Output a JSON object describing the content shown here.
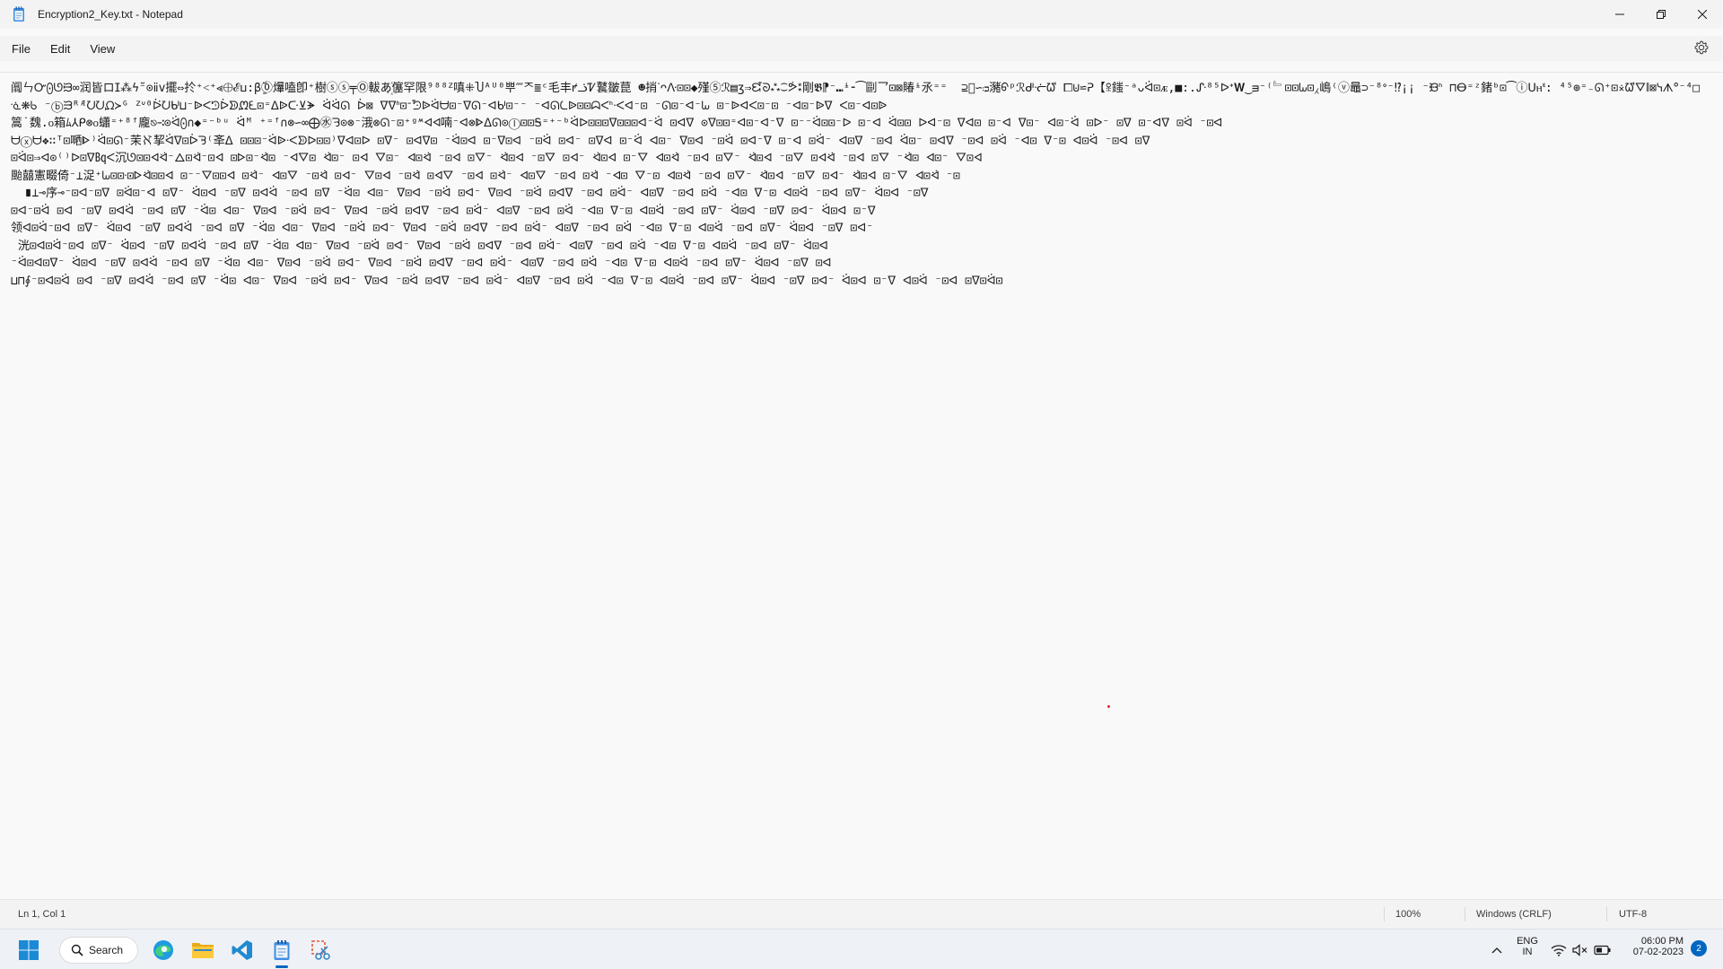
{
  "window": {
    "title": "Encryption2_Key.txt - Notepad"
  },
  "menu": {
    "items": [
      "File",
      "Edit",
      "View"
    ]
  },
  "editor": {
    "content": "阘ㄣᏅ⨀ᘎᙣ∞润皆ロⵊ⁂ϟ̃⁻⊙ⅱ‍v擺⇔扵⁺˂⁺⪡⨁ℰⳙ꞉β̱̆⓪爗嗑卽⁺樹ⓢⓢ╤Ⓞ軷あ꙰僿罕限⁹⁸⁸ᙆ嗔⁜Ⴎᴬᵁ⁰뿌⁗ᄌ≣ᶜ毛丰ꝵᓘᏤ鼚皺菎 ☻捎ᐝᴖᐽ⊡⊡◆殣⑤ℛ▤ʒ⇒ᘿᘐ⁂⁐ᕘ⁑剛𝕭⁋⁻⑉ᶤ⁃⁀剾乛⊡⊠賰ᶤ氶⁼⁼  ⊇᷁∽ᴞ瀦ᠪᵖℛᒇᓠᘺ ⧠⊍⋍ᕈ【ꕉ⁠䥀⁻ᵃᴗᐛ⊡ᴁ,■:.ᔚ⁸⁵ᐅᐩ𝐖‿ᴟ⁻⁽﹄⊡⊡ᘈ⊡⁁嶋⁽ⓥ鼂⊃⁻⁸ᐤ⁻⁉¡¡ ⁻ᙟᑋ ⊓ⴱ⁼ᶻ鍺ᵇ⊡⁀ⓘᑌⲏᓫ: ⁴⁵⊕⁼₋ᘏ⁺⊡⨰ᘺᐁ∥⊠ᓭᗑᐤ⁻⁴□ᓍ⁕ᑲ ⁻ⓑᙐᴿᴭᘢᘢᘵ≻ᴳ ᙆᐡ⁰ᐖᘢᒈ⊔⁻ᐉᐸᘥᐆᗥᘻᘍ⊡⁼ᐃᐉᑢ⊻ᗘ ᐛᐛᘏ ᐆ⊠ ᐁᐁᑋ⊡ᐨᘬᐉᐛᗨ⊡⁻ᐁᘏ⁻ᐊᒈ⊡⁻⁻ ⁻ᐊᘏᘇᐉ⊡⊡ᗣᐸᑋᐧᐸᐊ⁻⊡ ⁻ᘏ⊡⁻ᐊ⁻ᘈ ⊡⁻ᐉᐊᐸ⊡⁻⊡ ⁻ᐊ⊡⁻ᐉᐁ ᐸ⊡⁻ᐊ⊡ᐉ\n篙˙魏.᧐箱ﾑ⅄ᑭ⊗᧐蠨⁼⁺⁸ᶠ龐⎋∹⊙ᐛ⨀∩◆⁼⁻ᵇᵘ ᐛᴹ ⁺⁼ᶠ∩⊗∽∞⨁㊌ᘌ⊙⊗⁻涐⊗ᘏ⁻⊡⁺ᵍᔿᐊᐊ喃⁻ᐊ⊗ᐈᐃᘏ⊙Ⓘ⊡⊡Ꭶ⁼⁺⁻ᵇᐛᐅ⊡⊡⊡ᐁ⊡⊡⊡ᐊ⁻ᐛ ⊡ᐊᐁ ⊙ᐁ⊡⊡⁼ᐊ⊡⁻ᐊ⁻ᐁ ⊡⁻⁻ᐛ⊡⊡⁻ᐅ ⊡⁻ᐊ ᐛ⊡⊡ ᐅᐊ⁻⊡ ᐁᐊ⊡ ⊡⁻ᐊ ᐁ⊡⁻ ᐊ⊡⁻ᐛ ⊡ᐅ⁻ ⊡ᐁ ⊡⁻ᐊᐁ ⊡ᐛ ⁻⊡ᐊ\nᗨⓧᗨ❖∷ᵀ⊡嗮ᐈ⁾ᐛ⊡ᘏ⁻茉ℵ挈ᐛᐁ⊡ᐆᘋ⁽㪯ᐃ ⊡⊡⊡⁻ᐛᐉᐧᐸᗥᐅ⊡⊡⁾ᐁᐊ⊡ᐅ ⊡ᐁ⁻ ⊡ᐊᐁ⊡ ⁻ᐛ⊡ᐊ ⊡⁻ᐁ⊡ᐊ ⁻⊡ᐛ ⊡ᐊ⁻ ⊡ᐁᐊ ⊡⁻ᐛ ᐊ⊡⁻ ᐁ⊡ᐊ ⁻⊡ᐛ ⊡ᐊ⁻ᐁ ⊡⁻ᐊ ⊡ᐛ⁻ ᐊ⊡ᐁ ⁻⊡ᐊ ᐛ⊡⁻ ⊡ᐊᐁ ⁻⊡ᐊ ⊡ᐛ ⁻ᐊ⊡ ᐁ⁻⊡ ᐊ⊡ᐛ ⁻⊡ᐊ ⊡ᐁ\n⊡ᐛ⊡⇒ᐊ⊙⁽⁾ᐅ⊡ᐁ㏃ᐸ沉ᘎ⊡⊡ᐊᐛ⁻ᐃ⊡ᐛ⁻⊡ᐊ ⊡ᐅ⊡⁻ᐛ⊡ ⁻ᐊᐁ⊡ ᐛ⊡⁻ ⊡ᐊ ᐁ⊡⁻ ᐊ⊡ᐛ ⁻⊡ᐊ ⊡ᐁ⁻ ᐛ⊡ᐊ ⁻⊡ᐁ ⊡ᐊ⁻ ᐛ⊡ᐊ ⊡⁻ᐁ ᐊ⊡ᐛ ⁻⊡ᐊ ⊡ᐁ⁻ ᐛ⊡ᐊ ⁻⊡ᐁ ⊡ᐊᐛ ⁻⊡ᐊ ⊡ᐁ ⁻ᐛ⊡ ᐊ⊡⁻ ᐁ⊡ᐊ\n颱囍憲畷倚⁻⊥浞⁺ᘈ⊡⊡ᐧ⊡ᐅᐛ⊡⊡ᐊ ⊡⁻⁻ᐁ⊡⊡ᐊ ⊡ᐛ⁻ ᐊ⊡ᐁ ⁻⊡ᐛ ⊡ᐊ⁻ ᐁ⊡ᐊ ⁻⊡ᐛ ⊡ᐊᐁ ⁻⊡ᐊ ⊡ᐛ⁻ ᐊ⊡ᐁ ⁻⊡ᐊ ⊡ᐛ ⁻ᐊ⊡ ᐁ⁻⊡ ᐊ⊡ᐛ ⁻⊡ᐊ ⊡ᐁ⁻ ᐛ⊡ᐊ ⁻⊡ᐁ ⊡ᐊ⁻ ᐛ⊡ᐊ ⊡⁻ᐁ ᐊ⊡ᐛ ⁻⊡\n  ∎⊥⊸序⊸⁻⊡ᐊ⁻⊡ᐁ ⊡ᐛ⊡⁻ᐊ ⊡ᐁ⁻ ᐛ⊡ᐊ ⁻⊡ᐁ ⊡ᐊᐛ ⁻⊡ᐊ ⊡ᐁ ⁻ᐛ⊡ ᐊ⊡⁻ ᐁ⊡ᐊ ⁻⊡ᐛ ⊡ᐊ⁻ ᐁ⊡ᐊ ⁻⊡ᐛ ⊡ᐊᐁ ⁻⊡ᐊ ⊡ᐛ⁻ ᐊ⊡ᐁ ⁻⊡ᐊ ⊡ᐛ ⁻ᐊ⊡ ᐁ⁻⊡ ᐊ⊡ᐛ ⁻⊡ᐊ ⊡ᐁ⁻ ᐛ⊡ᐊ ⁻⊡ᐁ\n⊡ᐊ⁻⊡ᐛ ⊡ᐊ ⁻⊡ᐁ ⊡ᐊᐛ ⁻⊡ᐊ ⊡ᐁ ⁻ᐛ⊡ ᐊ⊡⁻ ᐁ⊡ᐊ ⁻⊡ᐛ ⊡ᐊ⁻ ᐁ⊡ᐊ ⁻⊡ᐛ ⊡ᐊᐁ ⁻⊡ᐊ ⊡ᐛ⁻ ᐊ⊡ᐁ ⁻⊡ᐊ ⊡ᐛ ⁻ᐊ⊡ ᐁ⁻⊡ ᐊ⊡ᐛ ⁻⊡ᐊ ⊡ᐁ⁻ ᐛ⊡ᐊ ⁻⊡ᐁ ⊡ᐊ⁻ ᐛ⊡ᐊ ⊡⁻ᐁ\n领ᐊ⊡ᐛ⁻⊡ᐊ ⊡ᐁ⁻ ᐛ⊡ᐊ ⁻⊡ᐁ ⊡ᐊᐛ ⁻⊡ᐊ ⊡ᐁ ⁻ᐛ⊡ ᐊ⊡⁻ ᐁ⊡ᐊ ⁻⊡ᐛ ⊡ᐊ⁻ ᐁ⊡ᐊ ⁻⊡ᐛ ⊡ᐊᐁ ⁻⊡ᐊ ⊡ᐛ⁻ ᐊ⊡ᐁ ⁻⊡ᐊ ⊡ᐛ ⁻ᐊ⊡ ᐁ⁻⊡ ᐊ⊡ᐛ ⁻⊡ᐊ ⊡ᐁ⁻ ᐛ⊡ᐊ ⁻⊡ᐁ ⊡ᐊ⁻\n 洸⊡ᐊ⊡ᐛ⁻⊡ᐊ ⊡ᐁ⁻ ᐛ⊡ᐊ ⁻⊡ᐁ ⊡ᐊᐛ ⁻⊡ᐊ ⊡ᐁ ⁻ᐛ⊡ ᐊ⊡⁻ ᐁ⊡ᐊ ⁻⊡ᐛ ⊡ᐊ⁻ ᐁ⊡ᐊ ⁻⊡ᐛ ⊡ᐊᐁ ⁻⊡ᐊ ⊡ᐛ⁻ ᐊ⊡ᐁ ⁻⊡ᐊ ⊡ᐛ ⁻ᐊ⊡ ᐁ⁻⊡ ᐊ⊡ᐛ ⁻⊡ᐊ ⊡ᐁ⁻ ᐛ⊡ᐊ\n⁻ᐛ⊡ᐊ⊡ᐁ⁻ ᐛ⊡ᐊ ⁻⊡ᐁ ⊡ᐊᐛ ⁻⊡ᐊ ⊡ᐁ ⁻ᐛ⊡ ᐊ⊡⁻ ᐁ⊡ᐊ ⁻⊡ᐛ ⊡ᐊ⁻ ᐁ⊡ᐊ ⁻⊡ᐛ ⊡ᐊᐁ ⁻⊡ᐊ ⊡ᐛ⁻ ᐊ⊡ᐁ ⁻⊡ᐊ ⊡ᐛ ⁻ᐊ⊡ ᐁ⁻⊡ ᐊ⊡ᐛ ⁻⊡ᐊ ⊡ᐁ⁻ ᐛ⊡ᐊ ⁻⊡ᐁ ⊡ᐊ\n⊔⊓∮⁻⊡ᐊ⊡ᐛ ⊡ᐊ ⁻⊡ᐁ ⊡ᐊᐛ ⁻⊡ᐊ ⊡ᐁ ⁻ᐛ⊡ ᐊ⊡⁻ ᐁ⊡ᐊ ⁻⊡ᐛ ⊡ᐊ⁻ ᐁ⊡ᐊ ⁻⊡ᐛ ⊡ᐊᐁ ⁻⊡ᐊ ⊡ᐛ⁻ ᐊ⊡ᐁ ⁻⊡ᐊ ⊡ᐛ ⁻ᐊ⊡ ᐁ⁻⊡ ᐊ⊡ᐛ ⁻⊡ᐊ ⊡ᐁ⁻ ᐛ⊡ᐊ ⁻⊡ᐁ ⊡ᐊ⁻ ᐛ⊡ᐊ ⊡⁻ᐁ ᐊ⊡ᐛ ⁻⊡ᐊ ⊡ᐁ⊡ᐛ⊡"
  },
  "status": {
    "position": "Ln 1, Col 1",
    "zoom": "100%",
    "line_ending": "Windows (CRLF)",
    "encoding": "UTF-8"
  },
  "taskbar": {
    "search_label": "Search",
    "language_top": "ENG",
    "language_bottom": "IN",
    "time": "06:00 PM",
    "date": "07-02-2023",
    "notification_count": "2"
  },
  "colors": {
    "accent": "#0067c0",
    "caret_dot": "#e0262b"
  }
}
